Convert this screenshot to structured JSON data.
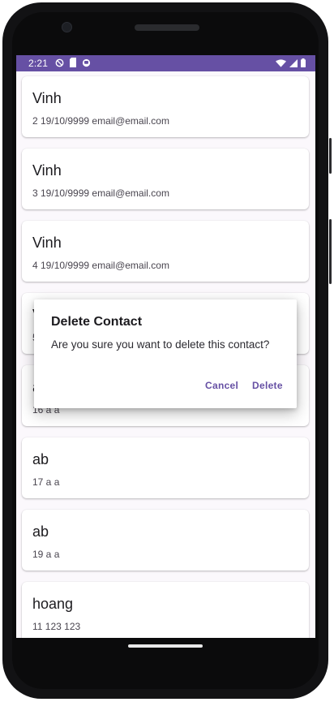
{
  "status_bar": {
    "time": "2:21",
    "left_icons": [
      "do-not-disturb-icon",
      "sd-card-icon",
      "sync-icon"
    ],
    "right_icons": [
      "wifi-icon",
      "cell-signal-icon",
      "battery-icon"
    ],
    "color": "#6650a4"
  },
  "contacts": [
    {
      "name": "Vinh",
      "details": "2 19/10/9999 email@email.com"
    },
    {
      "name": "Vinh",
      "details": "3 19/10/9999 email@email.com"
    },
    {
      "name": "Vinh",
      "details": "4 19/10/9999 email@email.com"
    },
    {
      "name": "V",
      "details": "5"
    },
    {
      "name": "a",
      "details": "16 a a"
    },
    {
      "name": "ab",
      "details": "17 a a"
    },
    {
      "name": "ab",
      "details": "19 a a"
    },
    {
      "name": "hoang",
      "details": "11 123 123"
    }
  ],
  "dialog": {
    "title": "Delete Contact",
    "message": "Are you sure you want to delete this contact?",
    "cancel_label": "Cancel",
    "delete_label": "Delete",
    "accent_color": "#6650a4"
  }
}
